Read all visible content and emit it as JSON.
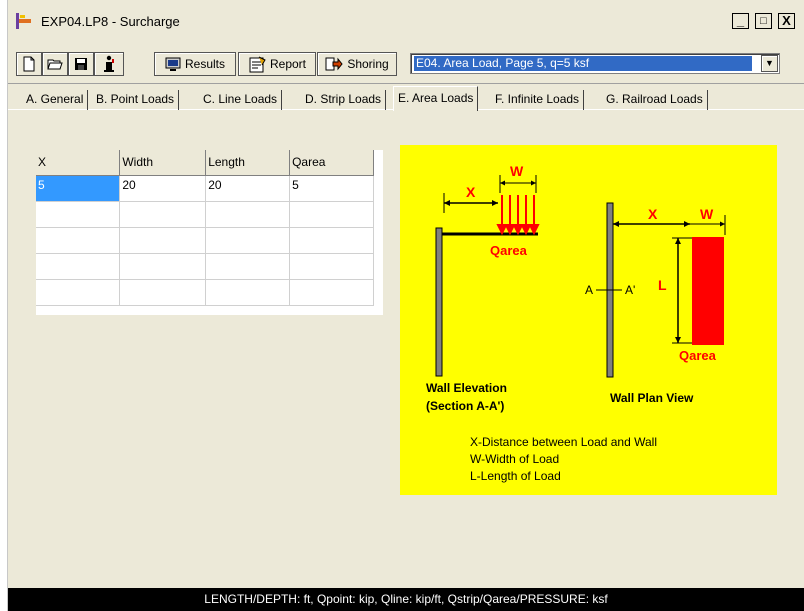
{
  "window": {
    "title": "EXP04.LP8 - Surcharge",
    "controls": [
      "_",
      "□",
      "X"
    ]
  },
  "toolbar": {
    "buttons": [
      {
        "name": "new-icon"
      },
      {
        "name": "open-icon"
      },
      {
        "name": "save-icon"
      },
      {
        "name": "info-icon"
      }
    ],
    "results_label": "Results",
    "report_label": "Report",
    "shoring_label": "Shoring",
    "example_select": "E04. Area Load, Page 5, q=5 ksf"
  },
  "tabs": [
    {
      "label": "A. General"
    },
    {
      "label": "B. Point Loads"
    },
    {
      "label": "C. Line Loads"
    },
    {
      "label": "D. Strip Loads"
    },
    {
      "label": "E. Area Loads",
      "active": true
    },
    {
      "label": "F. Infinite Loads"
    },
    {
      "label": "G. Railroad Loads"
    }
  ],
  "grid": {
    "columns": [
      "X",
      "Width",
      "Length",
      "Qarea"
    ],
    "rows": [
      [
        "5",
        "20",
        "20",
        "5"
      ],
      [
        "",
        "",
        "",
        ""
      ],
      [
        "",
        "",
        "",
        ""
      ],
      [
        "",
        "",
        "",
        ""
      ],
      [
        "",
        "",
        "",
        ""
      ]
    ]
  },
  "diagram": {
    "elevation": {
      "x_label": "X",
      "w_label": "W",
      "load_label": "Qarea",
      "title_line1": "Wall Elevation",
      "title_line2": "(Section A-A')"
    },
    "plan": {
      "x_label": "X",
      "w_label": "W",
      "l_label": "L",
      "a_label": "A",
      "a_prime_label": "A'",
      "load_label": "Qarea",
      "title": "Wall Plan View"
    },
    "legend": [
      "X-Distance between Load and Wall",
      "W-Width of Load",
      "L-Length of Load"
    ],
    "colors": {
      "background": "#ffff00",
      "load": "#ff0000",
      "wall": "#808080"
    }
  },
  "status": {
    "units": "LENGTH/DEPTH: ft, Qpoint: kip, Qline: kip/ft, Qstrip/Qarea/PRESSURE: ksf"
  }
}
